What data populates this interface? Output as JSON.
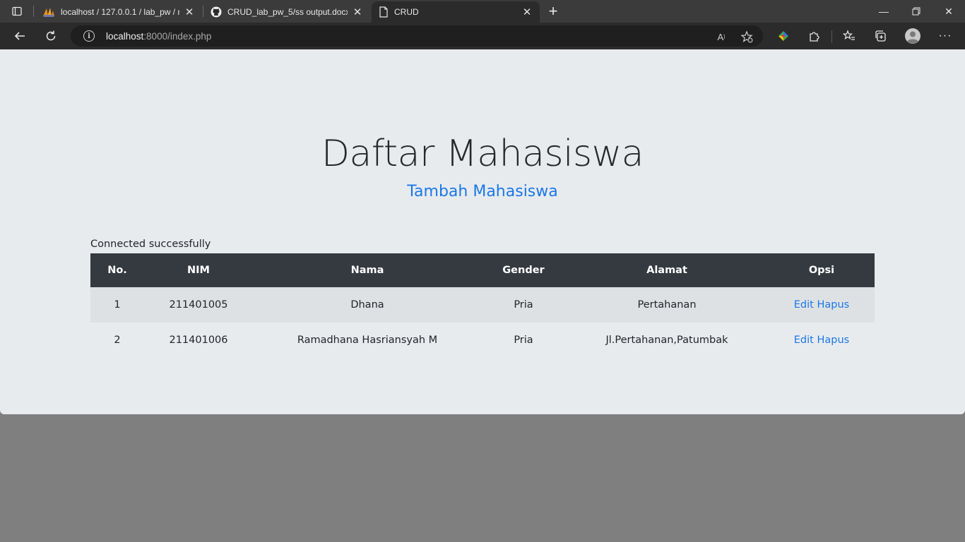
{
  "browser": {
    "tabs": [
      {
        "title": "localhost / 127.0.0.1 / lab_pw / m",
        "icon": "phpmyadmin-icon",
        "active": false
      },
      {
        "title": "CRUD_lab_pw_5/ss output.docx a",
        "icon": "github-icon",
        "active": false
      },
      {
        "title": "CRUD",
        "icon": "page-icon",
        "active": true
      }
    ],
    "url_host": "localhost",
    "url_rest": ":8000/index.php"
  },
  "page": {
    "heading": "Daftar Mahasiswa",
    "add_link": "Tambah Mahasiswa",
    "status": "Connected successfully",
    "table": {
      "headers": [
        "No.",
        "NIM",
        "Nama",
        "Gender",
        "Alamat",
        "Opsi"
      ],
      "rows": [
        {
          "no": "1",
          "nim": "211401005",
          "nama": "Dhana",
          "gender": "Pria",
          "alamat": "Pertahanan",
          "edit": "Edit",
          "hapus": "Hapus"
        },
        {
          "no": "2",
          "nim": "211401006",
          "nama": "Ramadhana Hasriansyah M",
          "gender": "Pria",
          "alamat": "Jl.Pertahanan,Patumbak",
          "edit": "Edit",
          "hapus": "Hapus"
        }
      ]
    }
  },
  "colors": {
    "link": "#1a78e6",
    "table_header": "#343a40",
    "page_bg": "#e8ebee"
  }
}
